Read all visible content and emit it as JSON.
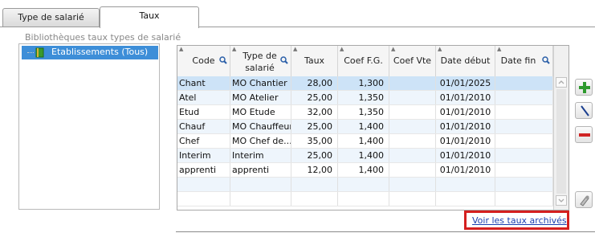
{
  "tabs": [
    {
      "label": "Type de salarié",
      "active": false
    },
    {
      "label": "Taux",
      "active": true
    }
  ],
  "library": {
    "label": "Bibliothèques taux types de salarié",
    "items": [
      {
        "label": "Etablissements (Tous)",
        "selected": true
      }
    ]
  },
  "grid": {
    "columns": [
      {
        "label": "Code",
        "searchable": true
      },
      {
        "label": "Type de salarié",
        "searchable": true
      },
      {
        "label": "Taux",
        "searchable": false
      },
      {
        "label": "Coef F.G.",
        "searchable": false
      },
      {
        "label": "Coef Vte",
        "searchable": false
      },
      {
        "label": "Date début",
        "searchable": false
      },
      {
        "label": "Date fin",
        "searchable": true
      }
    ],
    "rows": [
      {
        "code": "Chant",
        "type": "MO Chantier",
        "taux": "28,00",
        "coef_fg": "1,300",
        "coef_vte": "",
        "date_debut": "01/01/2025",
        "date_fin": ""
      },
      {
        "code": "Atel",
        "type": "MO Atelier",
        "taux": "25,00",
        "coef_fg": "1,350",
        "coef_vte": "",
        "date_debut": "01/01/2010",
        "date_fin": ""
      },
      {
        "code": "Etud",
        "type": "MO Etude",
        "taux": "32,00",
        "coef_fg": "1,350",
        "coef_vte": "",
        "date_debut": "01/01/2010",
        "date_fin": ""
      },
      {
        "code": "Chauf",
        "type": "MO Chauffeur",
        "taux": "25,00",
        "coef_fg": "1,400",
        "coef_vte": "",
        "date_debut": "01/01/2010",
        "date_fin": ""
      },
      {
        "code": "Chef",
        "type": "MO Chef de...",
        "taux": "35,00",
        "coef_fg": "1,400",
        "coef_vte": "",
        "date_debut": "01/01/2010",
        "date_fin": ""
      },
      {
        "code": "Interim",
        "type": "Interim",
        "taux": "25,00",
        "coef_fg": "1,400",
        "coef_vte": "",
        "date_debut": "01/01/2010",
        "date_fin": ""
      },
      {
        "code": "apprenti",
        "type": "apprenti",
        "taux": "12,00",
        "coef_fg": "1,400",
        "coef_vte": "",
        "date_debut": "01/01/2010",
        "date_fin": ""
      }
    ],
    "empty_rows": 2
  },
  "side_buttons": [
    {
      "name": "add-button",
      "icon": "plus-icon",
      "color": "#2e9a2e"
    },
    {
      "name": "edit-button",
      "icon": "pencil-icon",
      "color": "#1b3f8f"
    },
    {
      "name": "delete-button",
      "icon": "minus-icon",
      "color": "#d02525"
    },
    {
      "name": "archive-tool-button",
      "icon": "pen-tool-icon",
      "color": "#888888"
    }
  ],
  "archive_link": "Voir les taux archivés",
  "colors": {
    "selection": "#3d8ed8",
    "highlight_box": "#d41f1f",
    "link": "#1a3fb0"
  }
}
